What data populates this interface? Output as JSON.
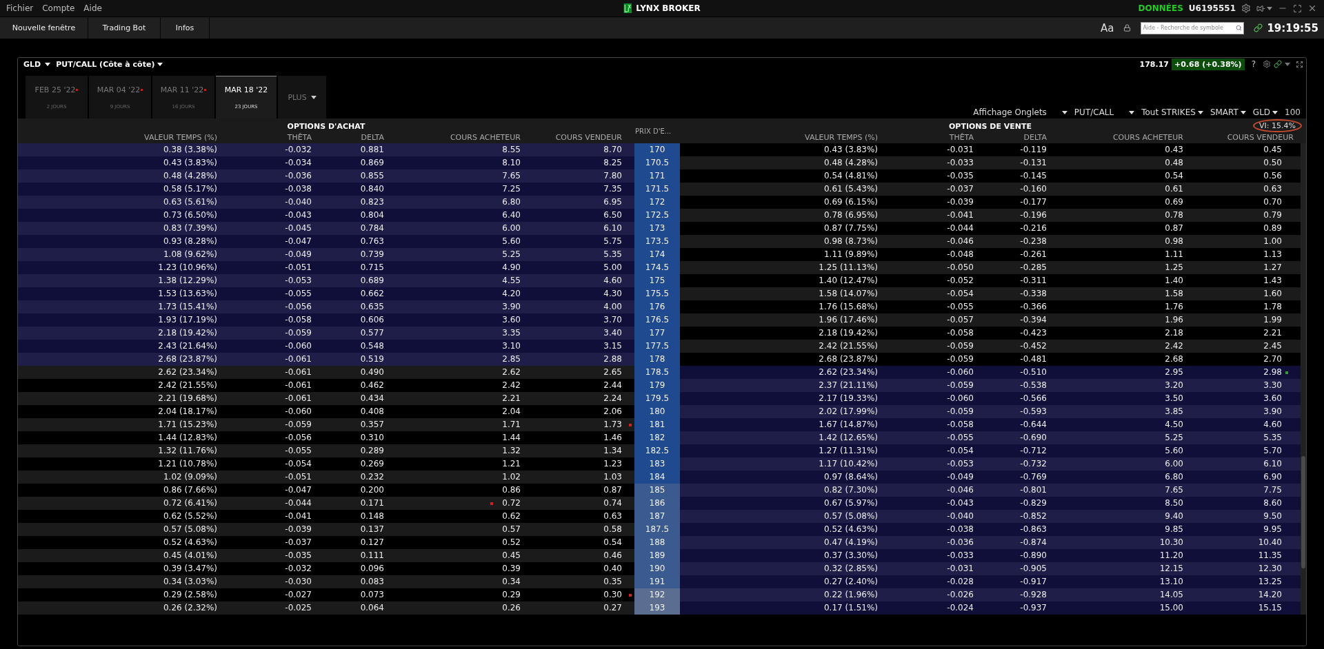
{
  "menu": [
    "Fichier",
    "Compte",
    "Aide"
  ],
  "brand": "LYNX BROKER",
  "data_status": "DONNÉES",
  "account": "U6195551",
  "toolbar_tabs": [
    "Nouvelle fenêtre",
    "Trading Bot",
    "Infos"
  ],
  "font_button": "Aa",
  "search": {
    "placeholder": "Aide - Recherche de symbole"
  },
  "clock": "19:19:55",
  "panel": {
    "symbol": "GLD",
    "view": "PUT/CALL (Côte à côte)",
    "last": "178.17",
    "change": "+0.68 (+0.38%)",
    "help": "?"
  },
  "expiries": [
    {
      "date": "FEB 25 '22",
      "days": "2 JOURS",
      "selected": false,
      "flagged": true
    },
    {
      "date": "MAR 04 '22",
      "days": "9 JOURS",
      "selected": false,
      "flagged": true
    },
    {
      "date": "MAR 11 '22",
      "days": "16 JOURS",
      "selected": false,
      "flagged": true
    },
    {
      "date": "MAR 18 '22",
      "days": "23 JOURS",
      "selected": true,
      "flagged": false
    }
  ],
  "more_tab": "PLUS",
  "controls": [
    {
      "label": "Affichage Onglets"
    },
    {
      "label": "PUT/CALL"
    },
    {
      "label": "Tout STRIKES"
    },
    {
      "label": "SMART"
    },
    {
      "label": "GLD"
    }
  ],
  "multiplier": "100",
  "vi": "VI: 15.4%",
  "calls_title": "OPTIONS D'ACHAT",
  "puts_title": "OPTIONS DE VENTE",
  "call_columns": [
    "VALEUR TEMPS (%)",
    "THÊTA",
    "DELTA",
    "COURS ACHETEUR",
    "COURS VENDEUR"
  ],
  "strike_column": "PRIX D'E...",
  "put_columns": [
    "VALEUR TEMPS (%)",
    "THÊTA",
    "DELTA",
    "COURS ACHETEUR",
    "COURS VENDEUR"
  ],
  "rows": [
    {
      "strike": "170",
      "color": "#1f4a90",
      "call_in_money": true,
      "call": [
        "0.38 (3.38%)",
        "-0.032",
        "0.881",
        "8.55",
        "8.70"
      ],
      "put": [
        "0.43 (3.83%)",
        "-0.031",
        "-0.119",
        "0.43",
        "0.45"
      ]
    },
    {
      "strike": "170.5",
      "color": "#1f4a90",
      "call_in_money": true,
      "call": [
        "0.43 (3.83%)",
        "-0.034",
        "0.869",
        "8.10",
        "8.25"
      ],
      "put": [
        "0.48 (4.28%)",
        "-0.033",
        "-0.131",
        "0.48",
        "0.50"
      ]
    },
    {
      "strike": "171",
      "color": "#1f4a90",
      "call_in_money": true,
      "call": [
        "0.48 (4.28%)",
        "-0.036",
        "0.855",
        "7.65",
        "7.80"
      ],
      "put": [
        "0.54 (4.81%)",
        "-0.035",
        "-0.145",
        "0.54",
        "0.56"
      ]
    },
    {
      "strike": "171.5",
      "color": "#1f4a90",
      "call_in_money": true,
      "call": [
        "0.58 (5.17%)",
        "-0.038",
        "0.840",
        "7.25",
        "7.35"
      ],
      "put": [
        "0.61 (5.43%)",
        "-0.037",
        "-0.160",
        "0.61",
        "0.63"
      ]
    },
    {
      "strike": "172",
      "color": "#1f4a90",
      "call_in_money": true,
      "call": [
        "0.63 (5.61%)",
        "-0.040",
        "0.823",
        "6.80",
        "6.95"
      ],
      "put": [
        "0.69 (6.15%)",
        "-0.039",
        "-0.177",
        "0.69",
        "0.70"
      ]
    },
    {
      "strike": "172.5",
      "color": "#1f4a90",
      "call_in_money": true,
      "call": [
        "0.73 (6.50%)",
        "-0.043",
        "0.804",
        "6.40",
        "6.50"
      ],
      "put": [
        "0.78 (6.95%)",
        "-0.041",
        "-0.196",
        "0.78",
        "0.79"
      ]
    },
    {
      "strike": "173",
      "color": "#1f4a90",
      "call_in_money": true,
      "call": [
        "0.83 (7.39%)",
        "-0.045",
        "0.784",
        "6.00",
        "6.10"
      ],
      "put": [
        "0.87 (7.75%)",
        "-0.044",
        "-0.216",
        "0.87",
        "0.89"
      ]
    },
    {
      "strike": "173.5",
      "color": "#1f4a90",
      "call_in_money": true,
      "call": [
        "0.93 (8.28%)",
        "-0.047",
        "0.763",
        "5.60",
        "5.75"
      ],
      "put": [
        "0.98 (8.73%)",
        "-0.046",
        "-0.238",
        "0.98",
        "1.00"
      ]
    },
    {
      "strike": "174",
      "color": "#1f4a90",
      "call_in_money": true,
      "call": [
        "1.08 (9.62%)",
        "-0.049",
        "0.739",
        "5.25",
        "5.35"
      ],
      "put": [
        "1.11 (9.89%)",
        "-0.048",
        "-0.261",
        "1.11",
        "1.13"
      ]
    },
    {
      "strike": "174.5",
      "color": "#1f4a90",
      "call_in_money": true,
      "call": [
        "1.23 (10.96%)",
        "-0.051",
        "0.715",
        "4.90",
        "5.00"
      ],
      "put": [
        "1.25 (11.13%)",
        "-0.050",
        "-0.285",
        "1.25",
        "1.27"
      ]
    },
    {
      "strike": "175",
      "color": "#1f4a90",
      "call_in_money": true,
      "call": [
        "1.38 (12.29%)",
        "-0.053",
        "0.689",
        "4.55",
        "4.60"
      ],
      "put": [
        "1.40 (12.47%)",
        "-0.052",
        "-0.311",
        "1.40",
        "1.43"
      ]
    },
    {
      "strike": "175.5",
      "color": "#1f4a90",
      "call_in_money": true,
      "call": [
        "1.53 (13.63%)",
        "-0.055",
        "0.662",
        "4.20",
        "4.30"
      ],
      "put": [
        "1.58 (14.07%)",
        "-0.054",
        "-0.338",
        "1.58",
        "1.60"
      ]
    },
    {
      "strike": "176",
      "color": "#1f4a90",
      "call_in_money": true,
      "call": [
        "1.73 (15.41%)",
        "-0.056",
        "0.635",
        "3.90",
        "4.00"
      ],
      "put": [
        "1.76 (15.68%)",
        "-0.055",
        "-0.366",
        "1.76",
        "1.78"
      ]
    },
    {
      "strike": "176.5",
      "color": "#1f4a90",
      "call_in_money": true,
      "call": [
        "1.93 (17.19%)",
        "-0.058",
        "0.606",
        "3.60",
        "3.70"
      ],
      "put": [
        "1.96 (17.46%)",
        "-0.057",
        "-0.394",
        "1.96",
        "1.99"
      ]
    },
    {
      "strike": "177",
      "color": "#1f4a90",
      "call_in_money": true,
      "call": [
        "2.18 (19.42%)",
        "-0.059",
        "0.577",
        "3.35",
        "3.40"
      ],
      "put": [
        "2.18 (19.42%)",
        "-0.058",
        "-0.423",
        "2.18",
        "2.21"
      ]
    },
    {
      "strike": "177.5",
      "color": "#1f4a90",
      "call_in_money": true,
      "call": [
        "2.43 (21.64%)",
        "-0.060",
        "0.548",
        "3.10",
        "3.15"
      ],
      "put": [
        "2.42 (21.55%)",
        "-0.059",
        "-0.452",
        "2.42",
        "2.45"
      ]
    },
    {
      "strike": "178",
      "color": "#1f4a90",
      "call_in_money": true,
      "call": [
        "2.68 (23.87%)",
        "-0.061",
        "0.519",
        "2.85",
        "2.88"
      ],
      "put": [
        "2.68 (23.87%)",
        "-0.059",
        "-0.481",
        "2.68",
        "2.70"
      ]
    },
    {
      "strike": "178.5",
      "color": "#1f4a90",
      "call_in_money": false,
      "call": [
        "2.62 (23.34%)",
        "-0.061",
        "0.490",
        "2.62",
        "2.65"
      ],
      "put": [
        "2.62 (23.34%)",
        "-0.060",
        "-0.510",
        "2.95",
        "2.98"
      ],
      "put_ask_dot": {
        "color": "#3a9a3a"
      }
    },
    {
      "strike": "179",
      "color": "#1f4a90",
      "call_in_money": false,
      "call": [
        "2.42 (21.55%)",
        "-0.061",
        "0.462",
        "2.42",
        "2.44"
      ],
      "put": [
        "2.37 (21.11%)",
        "-0.059",
        "-0.538",
        "3.20",
        "3.30"
      ]
    },
    {
      "strike": "179.5",
      "color": "#1f4a90",
      "call_in_money": false,
      "call": [
        "2.21 (19.68%)",
        "-0.061",
        "0.434",
        "2.21",
        "2.24"
      ],
      "put": [
        "2.17 (19.33%)",
        "-0.060",
        "-0.566",
        "3.50",
        "3.60"
      ]
    },
    {
      "strike": "180",
      "color": "#1f4a90",
      "call_in_money": false,
      "call": [
        "2.04 (18.17%)",
        "-0.060",
        "0.408",
        "2.04",
        "2.06"
      ],
      "put": [
        "2.02 (17.99%)",
        "-0.059",
        "-0.593",
        "3.85",
        "3.90"
      ]
    },
    {
      "strike": "181",
      "color": "#1f4a90",
      "call_in_money": false,
      "call": [
        "1.71 (15.23%)",
        "-0.059",
        "0.357",
        "1.71",
        "1.73"
      ],
      "put": [
        "1.67 (14.87%)",
        "-0.058",
        "-0.644",
        "4.50",
        "4.60"
      ],
      "call_ask_dot": {
        "color": "#d42020"
      }
    },
    {
      "strike": "182",
      "color": "#1f4a90",
      "call_in_money": false,
      "call": [
        "1.44 (12.83%)",
        "-0.056",
        "0.310",
        "1.44",
        "1.46"
      ],
      "put": [
        "1.42 (12.65%)",
        "-0.055",
        "-0.690",
        "5.25",
        "5.35"
      ]
    },
    {
      "strike": "182.5",
      "color": "#1f4a90",
      "call_in_money": false,
      "call": [
        "1.32 (11.76%)",
        "-0.055",
        "0.289",
        "1.32",
        "1.34"
      ],
      "put": [
        "1.27 (11.31%)",
        "-0.054",
        "-0.712",
        "5.60",
        "5.70"
      ]
    },
    {
      "strike": "183",
      "color": "#1f4a90",
      "call_in_money": false,
      "call": [
        "1.21 (10.78%)",
        "-0.054",
        "0.269",
        "1.21",
        "1.23"
      ],
      "put": [
        "1.17 (10.42%)",
        "-0.053",
        "-0.732",
        "6.00",
        "6.10"
      ]
    },
    {
      "strike": "184",
      "color": "#1f4a90",
      "call_in_money": false,
      "call": [
        "1.02 (9.09%)",
        "-0.051",
        "0.232",
        "1.02",
        "1.03"
      ],
      "put": [
        "0.97 (8.64%)",
        "-0.049",
        "-0.769",
        "6.80",
        "6.90"
      ]
    },
    {
      "strike": "185",
      "color": "#3b5b90",
      "call_in_money": false,
      "call": [
        "0.86 (7.66%)",
        "-0.047",
        "0.200",
        "0.86",
        "0.87"
      ],
      "put": [
        "0.82 (7.30%)",
        "-0.046",
        "-0.801",
        "7.65",
        "7.75"
      ]
    },
    {
      "strike": "186",
      "color": "#3b5b90",
      "call_in_money": false,
      "call": [
        "0.72 (6.41%)",
        "-0.044",
        "0.171",
        "0.72",
        "0.74"
      ],
      "put": [
        "0.67 (5.97%)",
        "-0.043",
        "-0.829",
        "8.50",
        "8.60"
      ],
      "call_bid_dot": {
        "color": "#d42020"
      }
    },
    {
      "strike": "187",
      "color": "#3b5b90",
      "call_in_money": false,
      "call": [
        "0.62 (5.52%)",
        "-0.041",
        "0.148",
        "0.62",
        "0.63"
      ],
      "put": [
        "0.57 (5.08%)",
        "-0.040",
        "-0.852",
        "9.40",
        "9.50"
      ]
    },
    {
      "strike": "187.5",
      "color": "#3b5b90",
      "call_in_money": false,
      "call": [
        "0.57 (5.08%)",
        "-0.039",
        "0.137",
        "0.57",
        "0.58"
      ],
      "put": [
        "0.52 (4.63%)",
        "-0.038",
        "-0.863",
        "9.85",
        "9.95"
      ]
    },
    {
      "strike": "188",
      "color": "#3b5b90",
      "call_in_money": false,
      "call": [
        "0.52 (4.63%)",
        "-0.037",
        "0.127",
        "0.52",
        "0.54"
      ],
      "put": [
        "0.47 (4.19%)",
        "-0.036",
        "-0.874",
        "10.30",
        "10.40"
      ]
    },
    {
      "strike": "189",
      "color": "#3b5b90",
      "call_in_money": false,
      "call": [
        "0.45 (4.01%)",
        "-0.035",
        "0.111",
        "0.45",
        "0.46"
      ],
      "put": [
        "0.37 (3.30%)",
        "-0.033",
        "-0.890",
        "11.20",
        "11.35"
      ]
    },
    {
      "strike": "190",
      "color": "#3b5b90",
      "call_in_money": false,
      "call": [
        "0.39 (3.47%)",
        "-0.032",
        "0.096",
        "0.39",
        "0.40"
      ],
      "put": [
        "0.32 (2.85%)",
        "-0.031",
        "-0.905",
        "12.15",
        "12.30"
      ]
    },
    {
      "strike": "191",
      "color": "#3b5b90",
      "call_in_money": false,
      "call": [
        "0.34 (3.03%)",
        "-0.030",
        "0.083",
        "0.34",
        "0.35"
      ],
      "put": [
        "0.27 (2.40%)",
        "-0.028",
        "-0.917",
        "13.10",
        "13.25"
      ]
    },
    {
      "strike": "192",
      "color": "#5b6d90",
      "call_in_money": false,
      "call": [
        "0.29 (2.58%)",
        "-0.027",
        "0.073",
        "0.29",
        "0.30"
      ],
      "put": [
        "0.22 (1.96%)",
        "-0.026",
        "-0.928",
        "14.05",
        "14.20"
      ],
      "call_ask_dot": {
        "color": "#d42020"
      }
    },
    {
      "strike": "193",
      "color": "#5b6d90",
      "call_in_money": false,
      "call": [
        "0.26 (2.32%)",
        "-0.025",
        "0.064",
        "0.26",
        "0.27"
      ],
      "put": [
        "0.17 (1.51%)",
        "-0.024",
        "-0.937",
        "15.00",
        "15.15"
      ]
    }
  ]
}
